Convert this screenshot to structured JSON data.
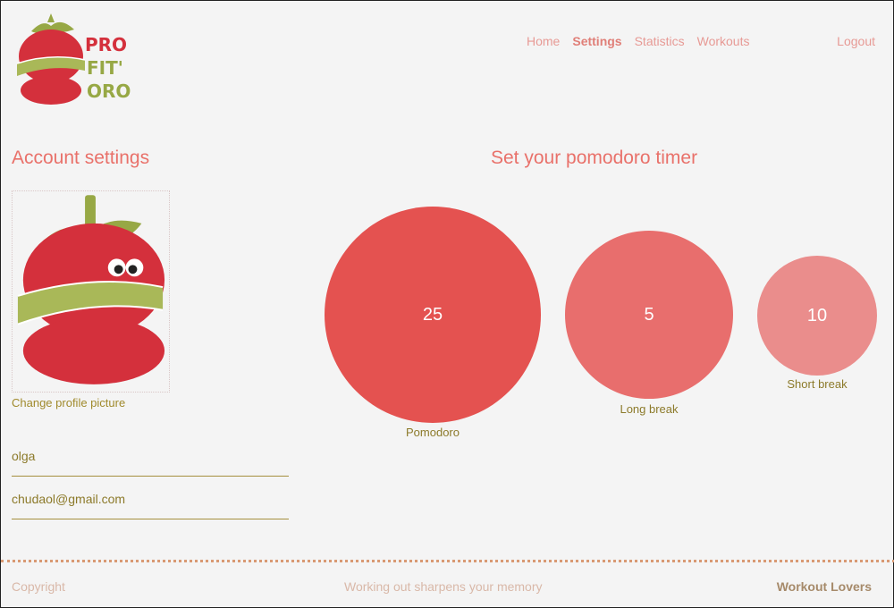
{
  "logo": {
    "icon": "tomato-measuring-tape-logo",
    "text_lines": [
      "PRO",
      "FIT'",
      "ORO"
    ]
  },
  "nav": {
    "items": [
      {
        "label": "Home",
        "active": false
      },
      {
        "label": "Settings",
        "active": true
      },
      {
        "label": "Statistics",
        "active": false
      },
      {
        "label": "Workouts",
        "active": false
      }
    ],
    "logout_label": "Logout"
  },
  "account": {
    "title": "Account settings",
    "profile_icon": "tomato-avatar",
    "change_picture_label": "Change profile picture",
    "name_value": "olga",
    "email_value": "chudaol@gmail.com"
  },
  "timer": {
    "title": "Set your pomodoro timer",
    "pomodoro": {
      "value": "25",
      "label": "Pomodoro"
    },
    "long_break": {
      "value": "5",
      "label": "Long break"
    },
    "short_break": {
      "value": "10",
      "label": "Short break"
    }
  },
  "footer": {
    "left": "Copyright",
    "middle": "Working out sharpens your memory",
    "right": "Workout Lovers"
  },
  "colors": {
    "accent": "#e9716a",
    "pomodoro": "#e45250",
    "long_break": "#e86e6d",
    "short_break": "#ea8d8c",
    "olive": "#8c7a2a"
  }
}
